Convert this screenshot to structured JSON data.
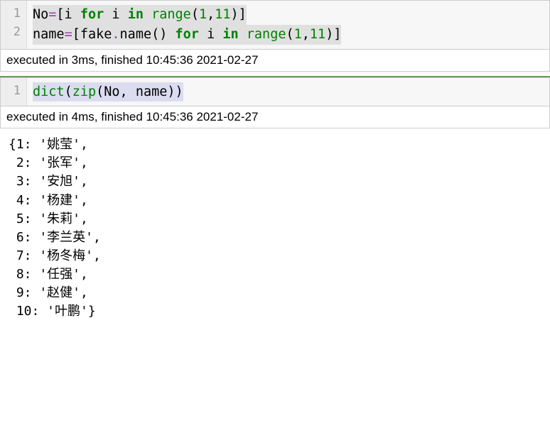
{
  "cell1": {
    "lineNumbers": [
      "1",
      "2"
    ],
    "line1": {
      "t1": "No",
      "t2": "=",
      "t3": "[i ",
      "t4": "for",
      "t5": " i ",
      "t6": "in",
      "t7": " ",
      "t8": "range",
      "t9": "(",
      "t10": "1",
      "t11": ",",
      "t12": "11",
      "t13": ")]"
    },
    "line2": {
      "t1": "name",
      "t2": "=",
      "t3": "[fake",
      "t4": ".",
      "t5": "name() ",
      "t6": "for",
      "t7": " i ",
      "t8": "in",
      "t9": " ",
      "t10": "range",
      "t11": "(",
      "t12": "1",
      "t13": ",",
      "t14": "11",
      "t15": ")]"
    },
    "timing": "executed in 3ms, finished 10:45:36 2021-02-27"
  },
  "cell2": {
    "lineNumbers": [
      "1"
    ],
    "line1": {
      "t1": "dict",
      "t2": "(",
      "t3": "zip",
      "t4": "(No, name))"
    },
    "timing": "executed in 4ms, finished 10:45:36 2021-02-27"
  },
  "output": "{1: '姚莹',\n 2: '张军',\n 3: '安旭',\n 4: '杨建',\n 5: '朱莉',\n 6: '李兰英',\n 7: '杨冬梅',\n 8: '任强',\n 9: '赵健',\n 10: '叶鹏'}"
}
